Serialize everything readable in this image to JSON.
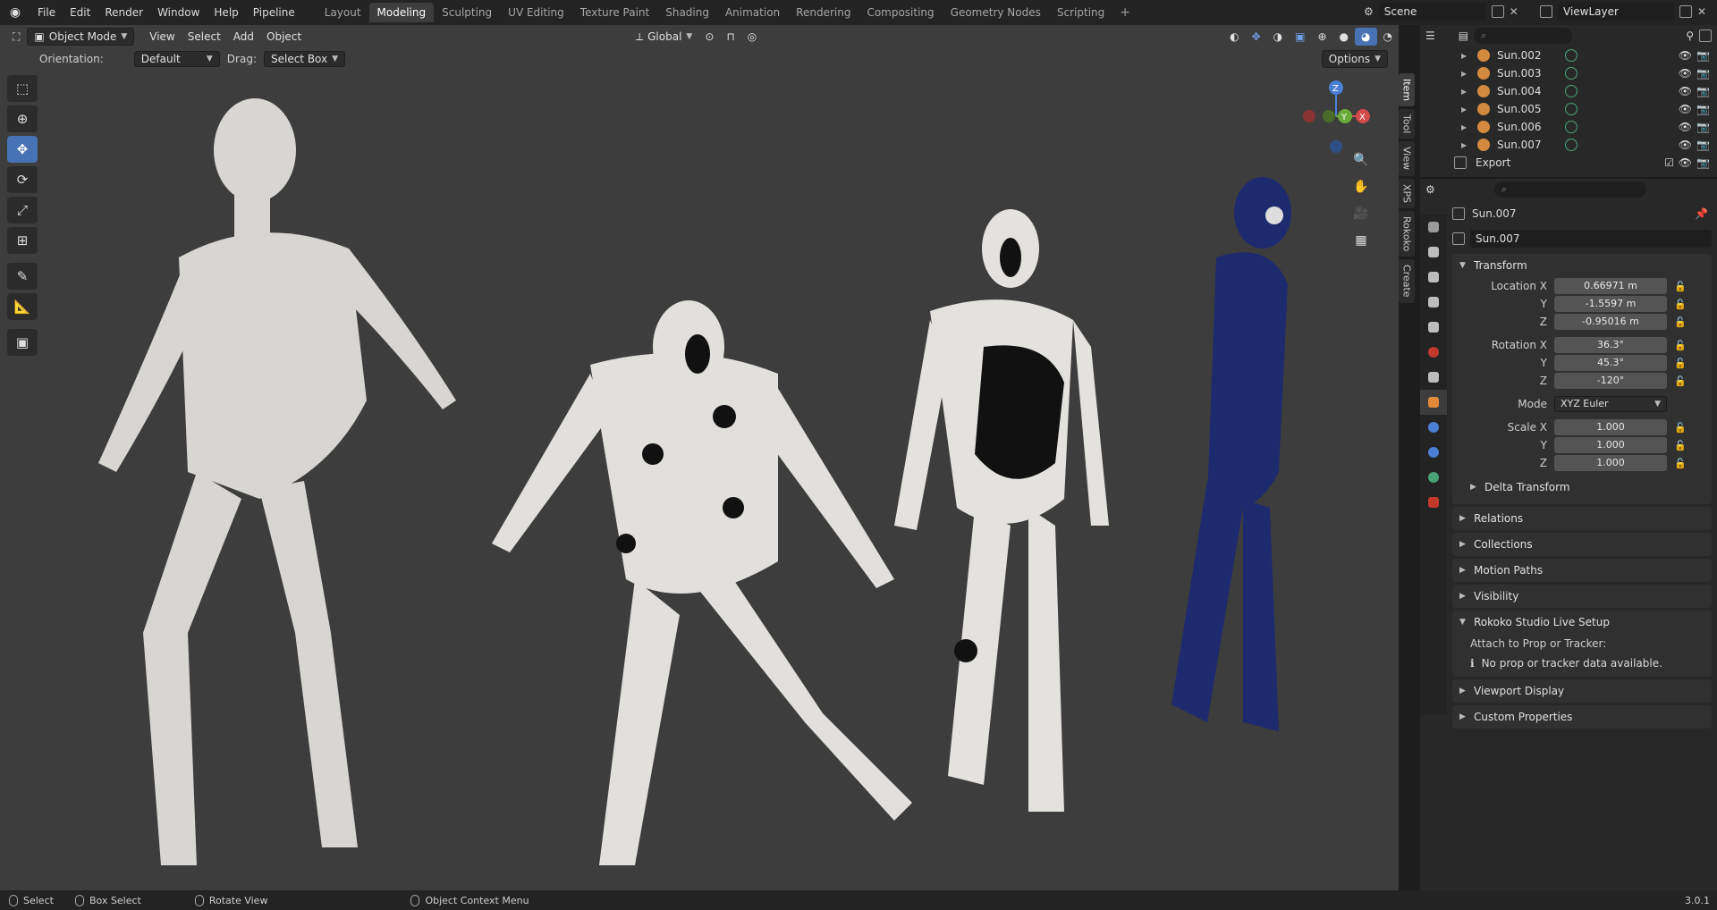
{
  "menu": {
    "items": [
      "File",
      "Edit",
      "Render",
      "Window",
      "Help",
      "Pipeline"
    ]
  },
  "workspaces": {
    "tabs": [
      "Layout",
      "Modeling",
      "Sculpting",
      "UV Editing",
      "Texture Paint",
      "Shading",
      "Animation",
      "Rendering",
      "Compositing",
      "Geometry Nodes",
      "Scripting"
    ],
    "active": "Modeling"
  },
  "scene": {
    "name": "Scene"
  },
  "view_layer": {
    "name": "ViewLayer"
  },
  "viewport": {
    "mode": "Object Mode",
    "menus": [
      "View",
      "Select",
      "Add",
      "Object"
    ],
    "transform_orientation": "Global",
    "orientation_label": "Orientation:",
    "orientation_value": "Default",
    "drag_label": "Drag:",
    "drag_value": "Select Box",
    "options_label": "Options",
    "side_tabs": [
      "Item",
      "Tool",
      "View",
      "XPS",
      "Rokoko",
      "Create"
    ],
    "gizmo": {
      "x": "X",
      "y": "Y",
      "z": "Z"
    }
  },
  "outliner": {
    "rows": [
      "Sun.002",
      "Sun.003",
      "Sun.004",
      "Sun.005",
      "Sun.006",
      "Sun.007"
    ],
    "collection": "Export"
  },
  "properties": {
    "object_name": "Sun.007",
    "datablock": "Sun.007",
    "transform_title": "Transform",
    "location": {
      "label_x": "Location X",
      "x": "0.66971 m",
      "y": "-1.5597 m",
      "z": "-0.95016 m"
    },
    "rotation": {
      "label_x": "Rotation X",
      "x": "36.3°",
      "y": "45.3°",
      "z": "-120°"
    },
    "mode_label": "Mode",
    "mode_value": "XYZ Euler",
    "scale": {
      "label_x": "Scale X",
      "x": "1.000",
      "y": "1.000",
      "z": "1.000"
    },
    "axis": {
      "y": "Y",
      "z": "Z"
    },
    "delta_transform": "Delta Transform",
    "panels": [
      "Relations",
      "Collections",
      "Motion Paths",
      "Visibility"
    ],
    "rokoko": {
      "title": "Rokoko Studio Live Setup",
      "attach_label": "Attach to Prop or Tracker:",
      "info": "No prop or tracker data available."
    },
    "panels_after": [
      "Viewport Display",
      "Custom Properties"
    ]
  },
  "status": {
    "select": "Select",
    "box_select": "Box Select",
    "rotate_view": "Rotate View",
    "context_menu": "Object Context Menu",
    "version": "3.0.1"
  }
}
